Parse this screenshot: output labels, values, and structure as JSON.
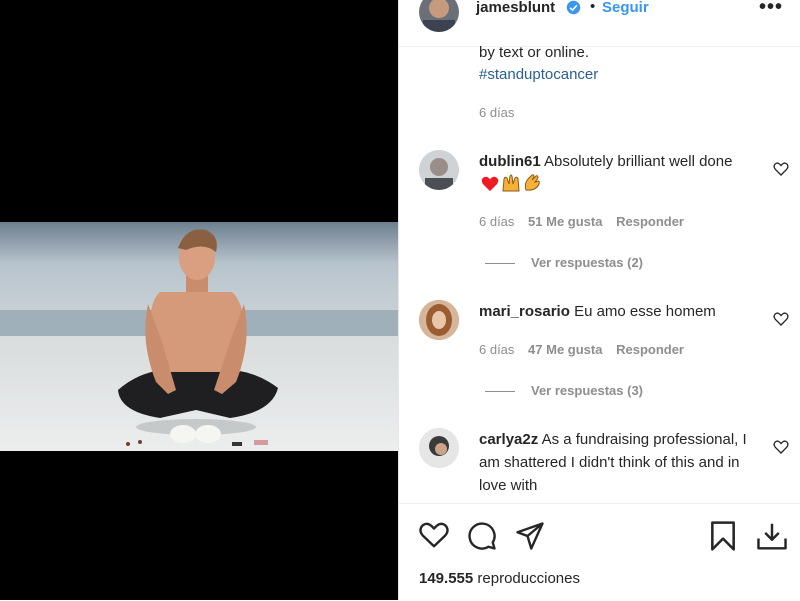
{
  "post": {
    "username": "jamesblunt",
    "follow_label": "Seguir",
    "dot": "•",
    "more_label": "•••"
  },
  "caption": {
    "line_text": "by text or online.",
    "hashtag": "#standuptocancer",
    "time": "6 días"
  },
  "comments": [
    {
      "user": "dublin61",
      "text": "Absolutely brilliant well done",
      "emojis": [
        "red-heart",
        "raising-hands",
        "clapping-hands"
      ],
      "time": "6 días",
      "likes": "51 Me gusta",
      "reply": "Responder",
      "replies": "Ver respuestas (2)"
    },
    {
      "user": "mari_rosario",
      "text": "Eu amo esse homem",
      "time": "6 días",
      "likes": "47 Me gusta",
      "reply": "Responder",
      "replies": "Ver respuestas (3)"
    },
    {
      "user": "carlya2z",
      "text": "As a fundraising professional, I am shattered I didn't think of this and in love with"
    }
  ],
  "stats": {
    "views": "149.555",
    "views_label": "reproducciones"
  },
  "icons": {
    "verified": "verified-badge-icon",
    "like": "heart-icon",
    "comment": "comment-icon",
    "share": "paper-plane-icon",
    "save": "bookmark-icon",
    "download": "download-icon"
  },
  "colors": {
    "accent": "#3897f0",
    "hashtag": "#2b5f92",
    "muted": "#8e8e8e",
    "text": "#262626",
    "heart": "#ed1c24"
  }
}
